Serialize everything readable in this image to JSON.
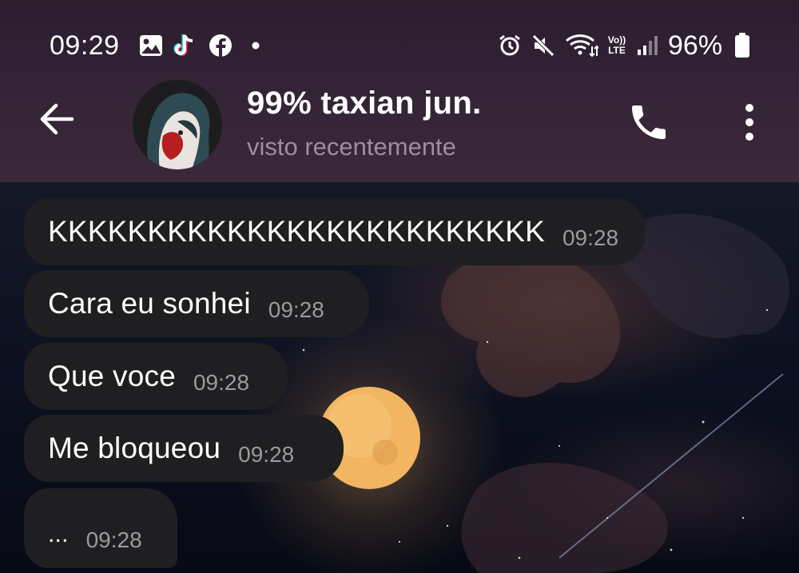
{
  "status_bar": {
    "time": "09:29",
    "left_icons": [
      "gallery-icon",
      "tiktok-icon",
      "facebook-icon",
      "notification-dot-icon"
    ],
    "right_icons": [
      "alarm-icon",
      "mute-icon",
      "wifi-icon",
      "volte-icon",
      "signal-icon",
      "battery-icon"
    ],
    "volte_label": "Vo)) LTE",
    "battery_percent": "96%"
  },
  "app_bar": {
    "back_icon": "arrow-left-icon",
    "title": "99% taxian jun.",
    "subtitle": "visto recentemente",
    "call_icon": "phone-icon",
    "menu_icon": "more-vertical-icon"
  },
  "messages": [
    {
      "text": "KKKKKKKKKKKKKKKKKKKKKKKKK",
      "time": "09:28"
    },
    {
      "text": "Cara eu sonhei",
      "time": "09:28"
    },
    {
      "text": "Que voce",
      "time": "09:28"
    },
    {
      "text": "Me bloqueou",
      "time": "09:28"
    },
    {
      "text": "...",
      "time": "09:28"
    }
  ],
  "colors": {
    "header_bg": "#352337",
    "bubble_bg": "#1f1f21",
    "time_text": "#9a9a9c",
    "subtitle_text": "#9c8e9c"
  }
}
